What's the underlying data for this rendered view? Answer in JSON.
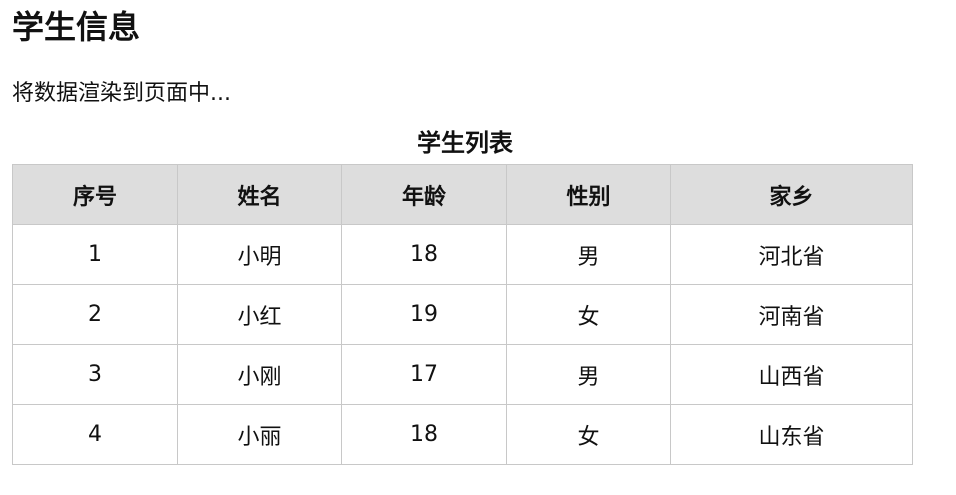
{
  "page": {
    "title": "学生信息",
    "description": "将数据渲染到页面中..."
  },
  "table": {
    "caption": "学生列表",
    "headers": [
      "序号",
      "姓名",
      "年龄",
      "性别",
      "家乡"
    ],
    "rows": [
      [
        "1",
        "小明",
        "18",
        "男",
        "河北省"
      ],
      [
        "2",
        "小红",
        "19",
        "女",
        "河南省"
      ],
      [
        "3",
        "小刚",
        "17",
        "男",
        "山西省"
      ],
      [
        "4",
        "小丽",
        "18",
        "女",
        "山东省"
      ]
    ]
  }
}
